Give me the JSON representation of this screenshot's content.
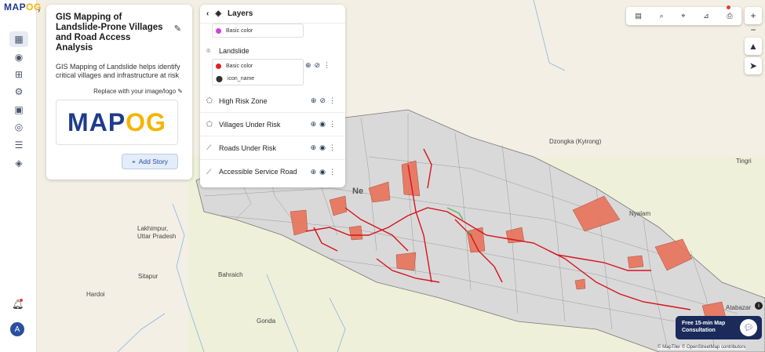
{
  "brand": {
    "logo_text_left": "MAP",
    "logo_text_right": "OG",
    "logo_big_left": "MAP",
    "logo_big_right": "OG"
  },
  "story": {
    "title": "GIS Mapping of Landslide-Prone Villages and Road Access Analysis",
    "description": "GIS Mapping of Landslide helps identify critical villages and infrastructure at risk",
    "replace_label": "Replace with your image/logo",
    "add_story_label": "Add Story"
  },
  "layers": {
    "header": "Layers",
    "items": [
      {
        "name": "",
        "styles": [
          {
            "label": "Basic color",
            "color": "#d63fd6"
          }
        ]
      },
      {
        "name": "Landslide",
        "styles": [
          {
            "label": "Basic color",
            "color": "#e02020"
          },
          {
            "label": "icon_name",
            "color": "#111111"
          }
        ]
      },
      {
        "name": "High Risk Zone"
      },
      {
        "name": "Villages Under Risk"
      },
      {
        "name": "Roads Under Risk"
      },
      {
        "name": "Accessible Service Road"
      }
    ]
  },
  "map_labels": {
    "lakhimpur": "Lakhimpur,",
    "uttar_pradesh": "Uttar Pradesh",
    "sitapur": "Sitapur",
    "bahraich": "Bahraich",
    "hardoi": "Hardoi",
    "gonda": "Gonda",
    "nepal": "Ne",
    "dzongka": "Dzongka (Kyirong)",
    "tingri": "Tingri",
    "nyalam": "Nyalam",
    "atabazar": "Atabazar"
  },
  "consult": {
    "line1": "Free 15-min Map",
    "line2": "Consultation"
  },
  "attribution": "© MapTiler © OpenStreetMap contributors",
  "user": {
    "initial": "A"
  },
  "colors": {
    "risk_fill": "#e8735a",
    "road": "#d6141c",
    "accent": "#2a4ea0"
  }
}
